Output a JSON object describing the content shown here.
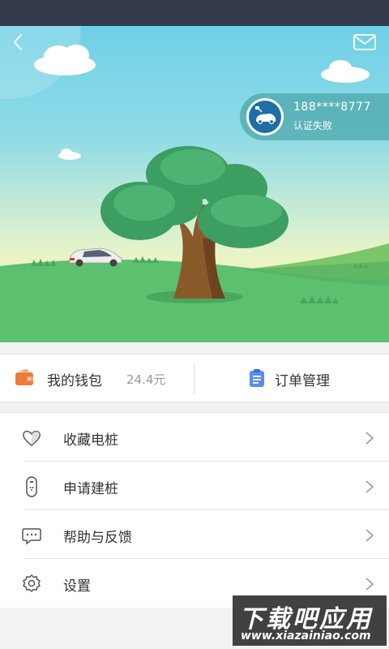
{
  "header": {
    "back_icon": "chevron-left-icon",
    "mail_icon": "mail-icon"
  },
  "user": {
    "phone": "188****8777",
    "status": "认证失败",
    "avatar_icon": "car-plug-icon"
  },
  "quick_bar": {
    "wallet_label": "我的钱包",
    "wallet_balance": "24.4元",
    "wallet_icon": "wallet-icon",
    "orders_label": "订单管理",
    "orders_icon": "clipboard-icon"
  },
  "menu": {
    "items": [
      {
        "label": "收藏电桩",
        "icon": "heart-icon"
      },
      {
        "label": "申请建桩",
        "icon": "charging-pile-icon"
      },
      {
        "label": "帮助与反馈",
        "icon": "chat-bubble-icon"
      },
      {
        "label": "设置",
        "icon": "gear-icon"
      }
    ]
  },
  "watermark": {
    "title": "下载吧应用",
    "url": "www.xiazainiao.com"
  },
  "colors": {
    "status_bar": "#333a4c",
    "sky_top": "#6fd0e7",
    "grass": "#5cc06e",
    "tree_leaves": "#3d9e62",
    "accent_orange": "#f07a3a",
    "accent_blue": "#5b8def"
  }
}
